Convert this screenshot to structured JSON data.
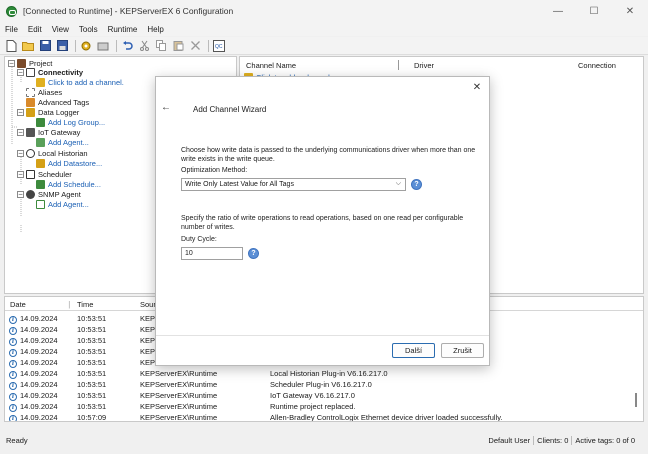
{
  "window": {
    "title": "[Connected to Runtime] - KEPServerEX 6 Configuration",
    "minimize": "—",
    "maximize": "☐",
    "close": "✕"
  },
  "menu": [
    "File",
    "Edit",
    "View",
    "Tools",
    "Runtime",
    "Help"
  ],
  "tree": {
    "project": "Project",
    "connectivity": "Connectivity",
    "add_channel": "Click to add a channel.",
    "aliases": "Aliases",
    "advanced_tags": "Advanced Tags",
    "data_logger": "Data Logger",
    "add_log_group": "Add Log Group...",
    "iot_gateway": "IoT Gateway",
    "add_agent": "Add Agent...",
    "local_historian": "Local Historian",
    "add_datastore": "Add Datastore...",
    "scheduler": "Scheduler",
    "add_schedule": "Add Schedule...",
    "snmp_agent": "SNMP Agent",
    "snmp_add_agent": "Add Agent..."
  },
  "channel_table": {
    "col_channel": "Channel Name",
    "col_driver": "Driver",
    "col_connection": "Connection",
    "add_row": "Click to add a channel."
  },
  "log": {
    "col_date": "Date",
    "col_time": "Time",
    "col_source": "Sourc",
    "rows": [
      {
        "date": "14.09.2024",
        "time": "10:53:51",
        "source": "KEPS",
        "event": ""
      },
      {
        "date": "14.09.2024",
        "time": "10:53:51",
        "source": "KEPS",
        "event": ""
      },
      {
        "date": "14.09.2024",
        "time": "10:53:51",
        "source": "KEPS",
        "event": ""
      },
      {
        "date": "14.09.2024",
        "time": "10:53:51",
        "source": "KEPS",
        "event": ""
      },
      {
        "date": "14.09.2024",
        "time": "10:53:51",
        "source": "KEPS",
        "event": ""
      },
      {
        "date": "14.09.2024",
        "time": "10:53:51",
        "source": "KEPServerEX\\Runtime",
        "event": "Local Historian Plug-in V6.16.217.0"
      },
      {
        "date": "14.09.2024",
        "time": "10:53:51",
        "source": "KEPServerEX\\Runtime",
        "event": "Scheduler Plug-in V6.16.217.0"
      },
      {
        "date": "14.09.2024",
        "time": "10:53:51",
        "source": "KEPServerEX\\Runtime",
        "event": "IoT Gateway V6.16.217.0"
      },
      {
        "date": "14.09.2024",
        "time": "10:53:51",
        "source": "KEPServerEX\\Runtime",
        "event": "Runtime project replaced."
      },
      {
        "date": "14.09.2024",
        "time": "10:57:09",
        "source": "KEPServerEX\\Runtime",
        "event": "Allen-Bradley ControlLogix Ethernet device driver loaded successfully."
      }
    ]
  },
  "status": {
    "left": "Ready",
    "user": "Default User",
    "clients": "Clients: 0",
    "active_tags": "Active tags: 0 of 0"
  },
  "dialog": {
    "back": "←",
    "close": "✕",
    "title": "Add Channel Wizard",
    "desc1": "Choose how write data is passed to the underlying communications driver when more than one write exists in the write queue.",
    "method_label": "Optimization Method:",
    "method_value": "Write Only Latest Value for All Tags",
    "desc2": "Specify the ratio of write operations to read operations, based on one read per configurable number of writes.",
    "duty_label": "Duty Cycle:",
    "duty_value": "10",
    "next": "Další",
    "cancel": "Zrušit"
  }
}
